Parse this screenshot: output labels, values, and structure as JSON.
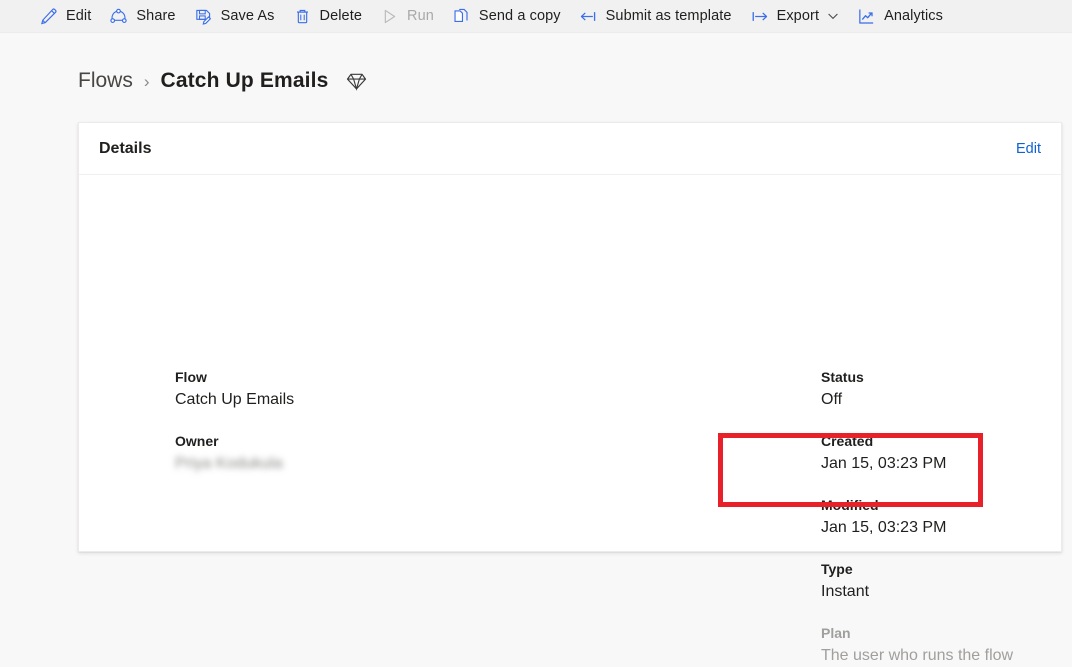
{
  "toolbar": {
    "items": [
      {
        "label": "Edit",
        "icon": "pencil-icon",
        "disabled": false,
        "chevron": false
      },
      {
        "label": "Share",
        "icon": "share-nodes-icon",
        "disabled": false,
        "chevron": false
      },
      {
        "label": "Save As",
        "icon": "save-as-icon",
        "disabled": false,
        "chevron": false
      },
      {
        "label": "Delete",
        "icon": "trash-icon",
        "disabled": false,
        "chevron": false
      },
      {
        "label": "Run",
        "icon": "play-icon",
        "disabled": true,
        "chevron": false
      },
      {
        "label": "Send a copy",
        "icon": "copy-pages-icon",
        "disabled": false,
        "chevron": false
      },
      {
        "label": "Submit as template",
        "icon": "arrow-left-bar-icon",
        "disabled": false,
        "chevron": false
      },
      {
        "label": "Export",
        "icon": "arrow-right-bar-icon",
        "disabled": false,
        "chevron": true
      },
      {
        "label": "Analytics",
        "icon": "line-chart-icon",
        "disabled": false,
        "chevron": false
      }
    ]
  },
  "breadcrumb": {
    "parent": "Flows",
    "separator": "›",
    "current": "Catch Up Emails",
    "badge_icon": "gem-icon"
  },
  "details_card": {
    "title": "Details",
    "edit_link": "Edit",
    "left_fields": [
      {
        "label": "Flow",
        "value": "Catch Up Emails",
        "blurred": false
      },
      {
        "label": "Owner",
        "value": "Priya Kodukula",
        "blurred": true
      }
    ],
    "right_fields": [
      {
        "label": "Status",
        "value": "Off"
      },
      {
        "label": "Created",
        "value": "Jan 15, 03:23 PM"
      },
      {
        "label": "Modified",
        "value": "Jan 15, 03:23 PM"
      },
      {
        "label": "Type",
        "value": "Instant"
      }
    ],
    "plan_field": {
      "label": "Plan",
      "value": "The user who runs the flow"
    }
  },
  "annotation": {
    "highlight_color": "#e8202a"
  },
  "colors": {
    "accent": "#0f62d1",
    "icon_blue": "#3b6ee8",
    "page_bg": "#f8f8f8",
    "toolbar_bg": "#f1f1f1",
    "text": "#201f1e",
    "muted_text": "#a19f9d",
    "disabled_text": "#a9a9a9"
  }
}
